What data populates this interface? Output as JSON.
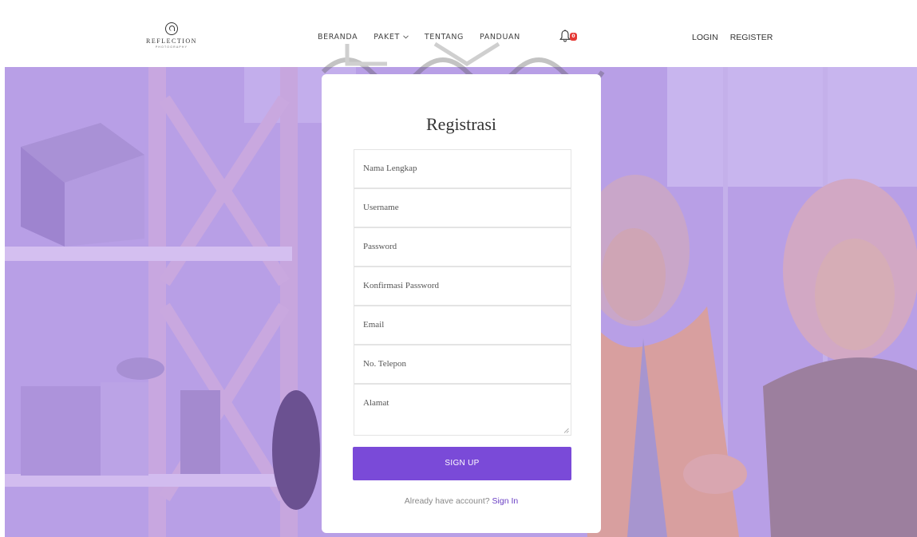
{
  "brand": {
    "name": "REFLECTION",
    "tagline": "PHOTOGRAPHY",
    "logo_icon": "reflection-logo-icon"
  },
  "nav": {
    "items": [
      {
        "label": "BERANDA"
      },
      {
        "label": "PAKET",
        "icon": "chevron-down-icon"
      },
      {
        "label": "TENTANG"
      },
      {
        "label": "PANDUAN"
      }
    ],
    "notification_count": "0",
    "login_label": "LOGIN",
    "register_label": "REGISTER"
  },
  "form": {
    "title": "Registrasi",
    "fields": [
      {
        "placeholder": "Nama Lengkap"
      },
      {
        "placeholder": "Username"
      },
      {
        "placeholder": "Password"
      },
      {
        "placeholder": "Konfirmasi Password"
      },
      {
        "placeholder": "Email"
      },
      {
        "placeholder": "No. Telepon"
      },
      {
        "placeholder": "Alamat"
      }
    ],
    "submit_label": "SIGN UP",
    "account_prompt": "Already have account?",
    "signin_label": "Sign In"
  },
  "colors": {
    "accent": "#7a4ad8",
    "overlay": "#b9a0e8",
    "badge": "#e53935"
  }
}
